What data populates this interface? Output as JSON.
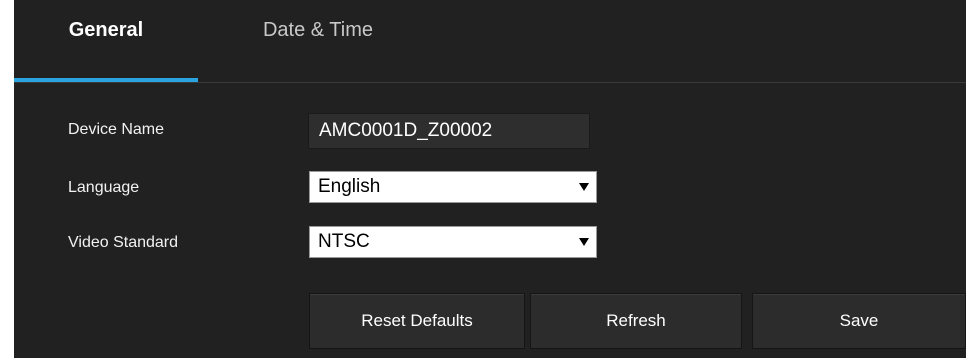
{
  "tabs": [
    {
      "label": "General",
      "active": true
    },
    {
      "label": "Date & Time",
      "active": false
    }
  ],
  "accent_color": "#2aa3e0",
  "form": {
    "device_name": {
      "label": "Device Name",
      "value": "AMC0001D_Z00002"
    },
    "language": {
      "label": "Language",
      "selected": "English"
    },
    "video_standard": {
      "label": "Video Standard",
      "selected": "NTSC"
    }
  },
  "buttons": {
    "reset_label": "Reset Defaults",
    "refresh_label": "Refresh",
    "save_label": "Save"
  }
}
